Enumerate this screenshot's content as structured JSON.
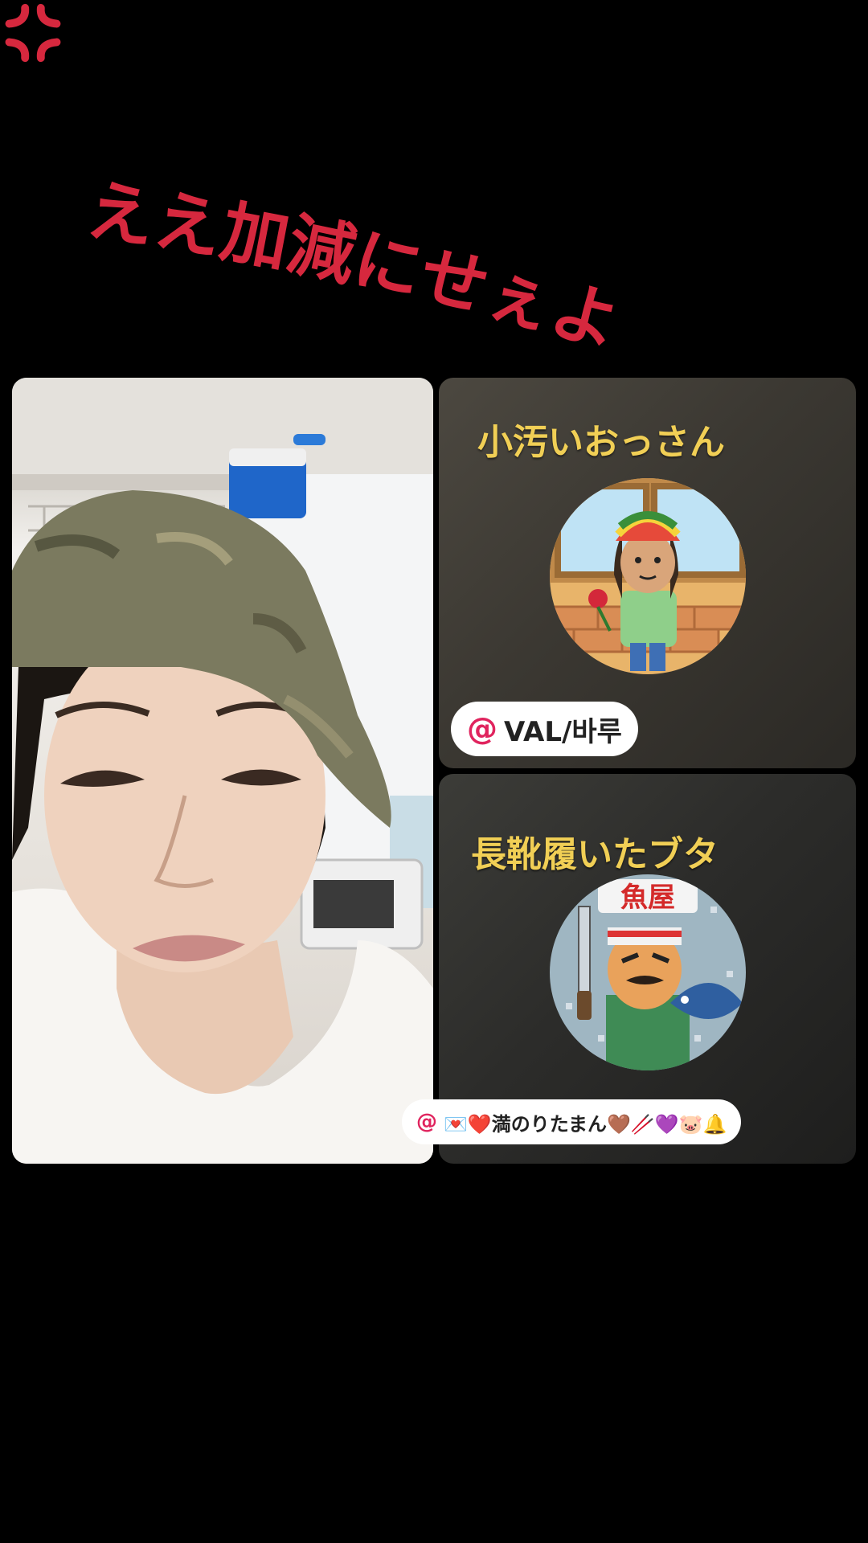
{
  "caption": {
    "text": "ええ加減にせぇよ💢",
    "color": "#d6283e",
    "icon": "anger-icon"
  },
  "host": {
    "tile_label": "host video"
  },
  "guests": [
    {
      "name": "小汚いおっさん",
      "handle_prefix": "@",
      "handle": "VAL/바루",
      "avatar": "cartoon man with rasta hat"
    },
    {
      "name": "長靴履いたブタ",
      "handle_prefix": "@",
      "handle": "💌❤️満のりたまん🤎🥢💜🐷🔔",
      "avatar": "fishmonger sticker",
      "avatar_banner": "魚屋"
    }
  ],
  "colors": {
    "name_gold": "#f1cf55",
    "handle_at": "#e0245e",
    "background": "#000000"
  }
}
